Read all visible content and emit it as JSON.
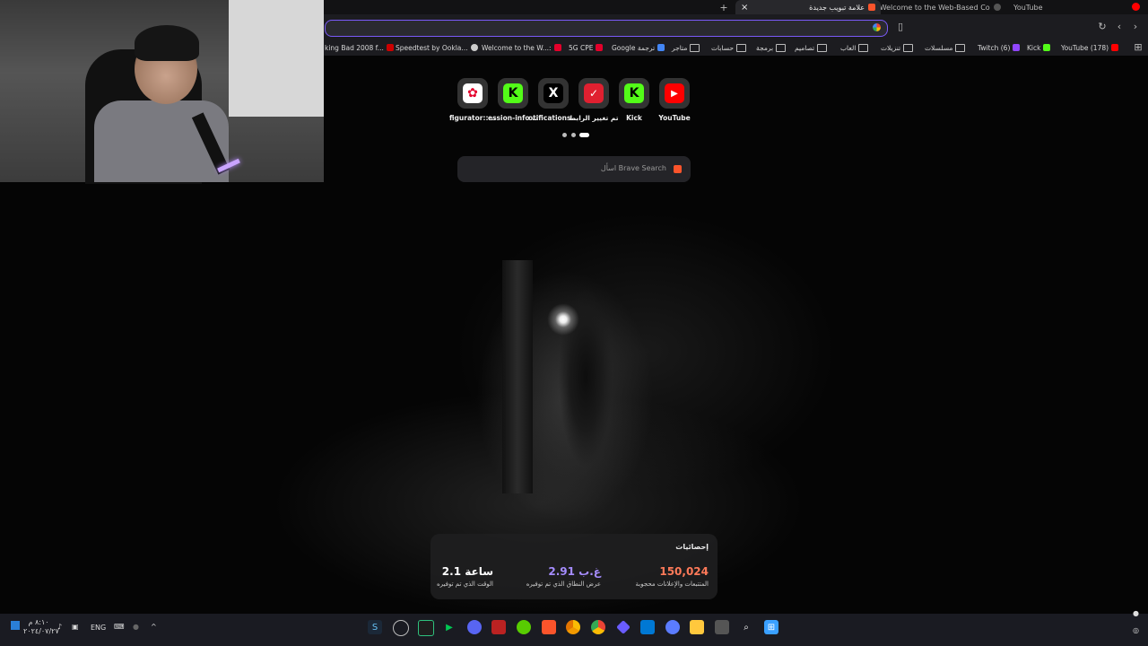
{
  "browser": {
    "tabs": [
      {
        "label": "YouTube",
        "favicon_color": "#ff0000"
      },
      {
        "label": ":Welcome to the Web-Based Config",
        "favicon_color": "#777777"
      },
      {
        "label": "علامة تبويب جديدة",
        "favicon_color": "#fb542b",
        "close": "×"
      }
    ],
    "new_tab_symbol": "+",
    "toolbar_icons": [
      "back-icon",
      "forward-icon",
      "reload-icon",
      "bookmark-icon",
      "google-icon"
    ],
    "bookmarks": [
      {
        "label": "YouTube (178)",
        "icon": "youtube-icon",
        "color": "#ff0000"
      },
      {
        "label": "Kick",
        "icon": "kick-icon",
        "color": "#53fc18"
      },
      {
        "label": "Twitch (6)",
        "icon": "twitch-icon",
        "color": "#9146ff"
      },
      {
        "label": "مسلسلات",
        "icon": "folder-icon"
      },
      {
        "label": "تنزيلات",
        "icon": "folder-icon"
      },
      {
        "label": "العاب",
        "icon": "folder-icon"
      },
      {
        "label": "تصاميم",
        "icon": "folder-icon"
      },
      {
        "label": "برمجة",
        "icon": "folder-icon"
      },
      {
        "label": "حسابات",
        "icon": "folder-icon"
      },
      {
        "label": "متاجر",
        "icon": "folder-icon"
      },
      {
        "label": "Google ترجمة",
        "icon": "translate-icon",
        "color": "#4285f4"
      },
      {
        "label": "5G CPE",
        "icon": "huawei-icon",
        "color": "#e4002b"
      },
      {
        "label": "Welcome to the W...:",
        "icon": "huawei-icon",
        "color": "#e4002b"
      },
      {
        "label": "Speedtest by Ookla...",
        "icon": "speedtest-icon",
        "color": "#cccccc"
      },
      {
        "label": "king Bad 2008 f...",
        "icon": "movie-icon",
        "color": "#c00"
      }
    ]
  },
  "shortcuts": [
    {
      "label": "YouTube",
      "icon": "youtube-icon",
      "bg": "#ff0000",
      "glyph": "▶"
    },
    {
      "label": "Kick",
      "icon": "kick-icon",
      "bg": "#53fc18",
      "glyph": "K"
    },
    {
      "label": "تم تغيير الرابط",
      "icon": "brand-check-icon",
      "bg": "#e02030",
      "glyph": "✓"
    },
    {
      "label": "otifications...",
      "icon": "x-icon",
      "bg": "#000000",
      "glyph": "X"
    },
    {
      "label": "ession-info ...",
      "icon": "kick-icon",
      "bg": "#53fc18",
      "glyph": "K"
    },
    {
      "label": "figurator::...",
      "icon": "huawei-icon",
      "bg": "#ffffff",
      "glyph": "✿"
    }
  ],
  "search": {
    "placeholder": "اسأل Brave Search",
    "icon": "brave-icon"
  },
  "stats": {
    "title": "إحصائيات",
    "items": [
      {
        "value": "150,024",
        "label": "المتتبعات والإعلانات محجوبة",
        "color": "#ff7a59"
      },
      {
        "value": "2.91 غ.ب",
        "label": "عرض النطاق الذي تم توفيره",
        "color": "#a58cff"
      },
      {
        "value": "2.1 ساعة",
        "label": "الوقت الذي تم توفيره",
        "color": "#ffffff"
      }
    ]
  },
  "taskbar": {
    "clock_time": "٨:١٠ م",
    "clock_date": "٢٠٢٤/٠٧/٢٧",
    "language": "ENG",
    "tray_icons": [
      "windows-icon",
      "speaker-icon",
      "network-icon",
      "keyboard-icon",
      "mic-icon",
      "chevron-up-icon"
    ],
    "apps": [
      {
        "icon": "start-icon",
        "color": "#3aa0ff"
      },
      {
        "icon": "search-icon",
        "color": "#ffffff"
      },
      {
        "icon": "task-view-icon",
        "color": "#cccccc"
      },
      {
        "icon": "file-explorer-icon",
        "color": "#ffc83d"
      },
      {
        "icon": "chatgpt-icon",
        "color": "#5b7cff"
      },
      {
        "icon": "outlook-icon",
        "color": "#0078d4"
      },
      {
        "icon": "vpn-icon",
        "color": "#6a5cff"
      },
      {
        "icon": "chrome-icon",
        "color": "#34a853"
      },
      {
        "icon": "chrome-canary-icon",
        "color": "#fbbc05"
      },
      {
        "icon": "brave-icon",
        "color": "#fb542b"
      },
      {
        "icon": "duolingo-icon",
        "color": "#58cc02"
      },
      {
        "icon": "obs-icon",
        "color": "#e33"
      },
      {
        "icon": "discord-icon",
        "color": "#5865f2"
      },
      {
        "icon": "play-icon",
        "color": "#00c853"
      },
      {
        "icon": "terminal-icon",
        "color": "#2ec27e"
      },
      {
        "icon": "clock-app-icon",
        "color": "#bbbbbb"
      },
      {
        "icon": "steam-icon",
        "color": "#66c0f4"
      }
    ]
  }
}
